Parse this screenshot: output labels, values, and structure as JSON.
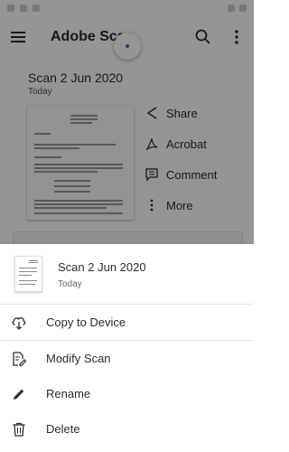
{
  "app": {
    "title": "Adobe Scan",
    "menu_icon": "hamburger-menu-icon",
    "search_icon": "search-icon",
    "overflow_icon": "more-vertical-icon"
  },
  "scan": {
    "title": "Scan 2 Jun 2020",
    "date": "Today"
  },
  "actions": [
    {
      "label": "Share",
      "icon": "share-icon"
    },
    {
      "label": "Acrobat",
      "icon": "acrobat-icon"
    },
    {
      "label": "Comment",
      "icon": "comment-icon"
    },
    {
      "label": "More",
      "icon": "more-vertical-icon"
    }
  ],
  "sheet": {
    "title": "Scan 2 Jun 2020",
    "date": "Today",
    "items": [
      {
        "label": "Copy to Device",
        "icon": "cloud-download-icon"
      },
      {
        "label": "Modify Scan",
        "icon": "modify-document-icon"
      },
      {
        "label": "Rename",
        "icon": "pencil-icon"
      },
      {
        "label": "Delete",
        "icon": "trash-icon"
      }
    ]
  },
  "colors": {
    "scrim": "#000000",
    "spinner_accent": "#2c66d6",
    "text": "#2c2c2c"
  }
}
